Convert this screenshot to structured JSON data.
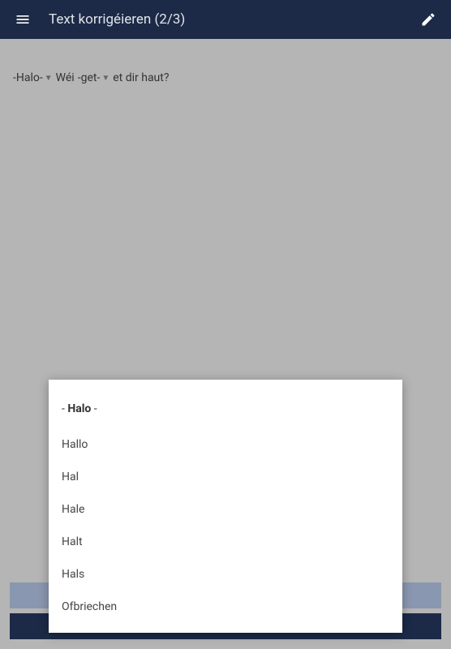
{
  "header": {
    "title": "Text korrigéieren (2/3)"
  },
  "sentence": {
    "word1": "Halo",
    "word1_prefix": "- ",
    "word1_suffix": " -",
    "word2": "Wéi",
    "word3": "get",
    "word3_prefix": "- ",
    "word3_suffix": " -",
    "word4": "et dir haut?"
  },
  "popup": {
    "current_prefix": "- ",
    "current_word": "Halo",
    "current_suffix": " -",
    "suggestions": [
      "Hallo",
      "Hal",
      "Hale",
      "Halt",
      "Hals"
    ],
    "cancel": "Ofbriechen"
  }
}
